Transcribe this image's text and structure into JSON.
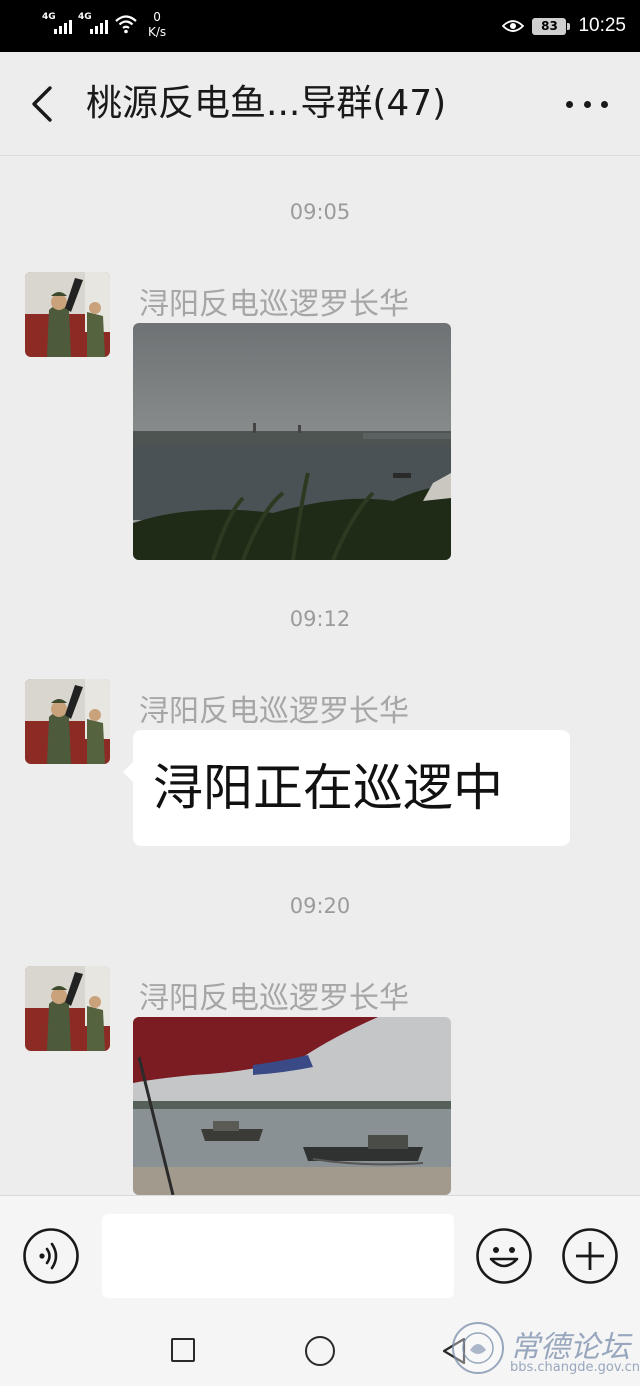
{
  "status_bar": {
    "network_1": "4G",
    "network_2": "4G",
    "speed_value": "0",
    "speed_unit": "K/s",
    "battery": "83",
    "time": "10:25"
  },
  "header": {
    "title": "桃源反电鱼...导群(47)"
  },
  "messages": [
    {
      "time": "09:05",
      "sender": "浔阳反电巡逻罗长华",
      "type": "image",
      "image_icon": "river-dam-photo"
    },
    {
      "time": "09:12",
      "sender": "浔阳反电巡逻罗长华",
      "type": "text",
      "text": "浔阳正在巡逻中"
    },
    {
      "time": "09:20",
      "sender": "浔阳反电巡逻罗长华",
      "type": "image",
      "image_icon": "river-boats-umbrella-photo"
    }
  ],
  "input_bar": {
    "value": "",
    "placeholder": ""
  },
  "watermark": {
    "text": "常德论坛",
    "url": "bbs.changde.gov.cn"
  },
  "colors": {
    "background": "#ededed",
    "status_bar": "#000000",
    "bubble": "#ffffff",
    "time_label": "#9b9b9b",
    "sender_name": "#a6a6a6"
  }
}
